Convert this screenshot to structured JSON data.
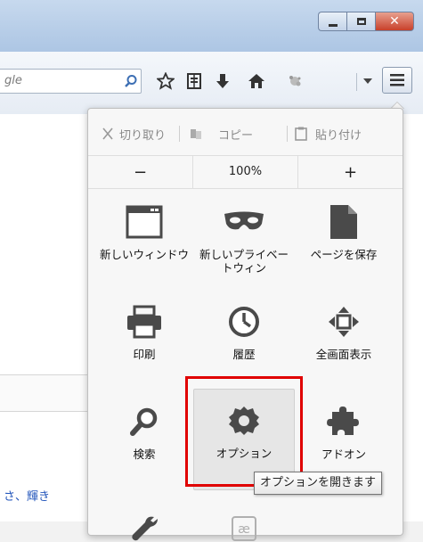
{
  "toolbar": {
    "search_partial_text": "gle"
  },
  "page": {
    "link_text": "さ、輝き"
  },
  "menu": {
    "edit": {
      "cut": "切り取り",
      "copy": "コピー",
      "paste": "貼り付け"
    },
    "zoom": {
      "out": "−",
      "level": "100%",
      "in": "+"
    },
    "items": [
      {
        "label": "新しいウィンドウ",
        "icon": "new-window-icon"
      },
      {
        "label": "新しいプライベートウィン",
        "icon": "private-mask-icon"
      },
      {
        "label": "ページを保存",
        "icon": "save-page-icon"
      },
      {
        "label": "印刷",
        "icon": "printer-icon"
      },
      {
        "label": "履歴",
        "icon": "history-clock-icon"
      },
      {
        "label": "全画面表示",
        "icon": "fullscreen-icon"
      },
      {
        "label": "検索",
        "icon": "magnifier-icon"
      },
      {
        "label": "オプション",
        "icon": "gear-icon"
      },
      {
        "label": "アドオン",
        "icon": "puzzle-icon"
      }
    ]
  },
  "tooltip": "オプションを開きます"
}
